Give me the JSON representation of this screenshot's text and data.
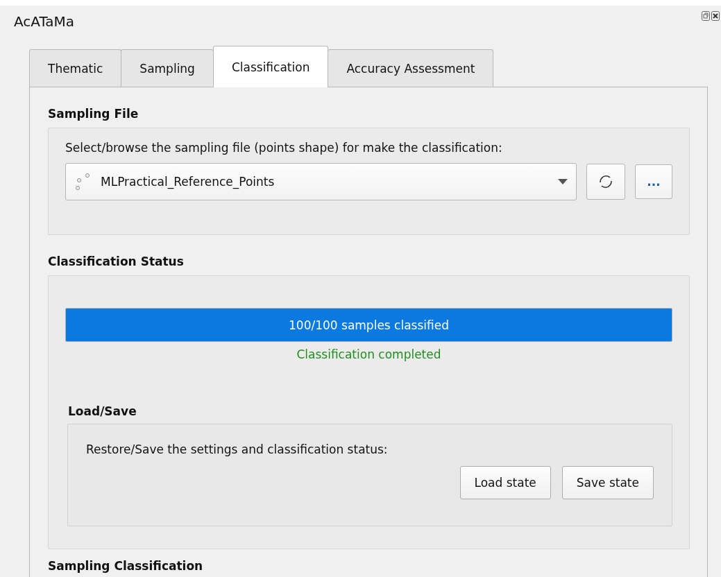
{
  "window": {
    "title": "AcATaMa"
  },
  "tabs": [
    {
      "label": "Thematic",
      "selected": false
    },
    {
      "label": "Sampling",
      "selected": false
    },
    {
      "label": "Classification",
      "selected": true
    },
    {
      "label": "Accuracy Assessment",
      "selected": false
    }
  ],
  "sampling_file": {
    "heading": "Sampling File",
    "instruction": "Select/browse the sampling file (points shape) for make the classification:",
    "layer": "MLPractical_Reference_Points",
    "browse_button": "..."
  },
  "classification_status": {
    "heading": "Classification Status",
    "progress": {
      "level": 1,
      "text": "100/100 samples classified"
    },
    "status": "Classification completed"
  },
  "load_save": {
    "heading": "Load/Save",
    "instruction": "Restore/Save the settings and classification status:",
    "buttons": [
      "Load state",
      "Save state"
    ]
  },
  "next_section": {
    "heading": "Sampling Classification"
  }
}
